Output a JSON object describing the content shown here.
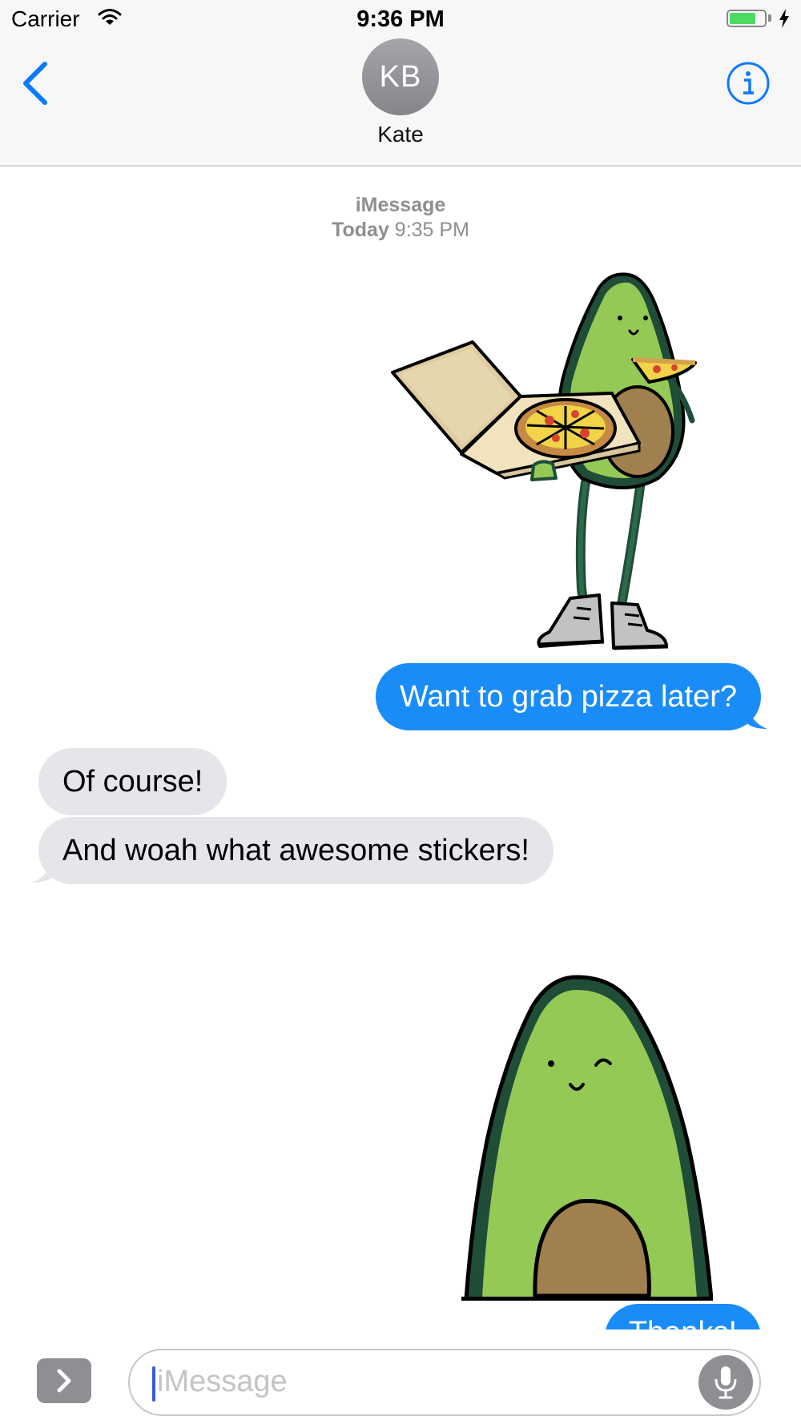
{
  "status_bar": {
    "carrier": "Carrier",
    "time": "9:36 PM",
    "battery_level": 0.75,
    "icons": [
      "wifi-icon",
      "battery-icon",
      "charging-bolt-icon"
    ]
  },
  "nav": {
    "back_icon": "chevron-left-icon",
    "avatar_initials": "KB",
    "contact_name": "Kate",
    "info_icon": "info-icon"
  },
  "thread": {
    "service": "iMessage",
    "day": "Today",
    "time": "9:35 PM",
    "messages": [
      {
        "type": "sticker",
        "from": "me",
        "sticker": "avocado-with-pizza-box"
      },
      {
        "type": "text",
        "from": "me",
        "text": "Want to grab pizza later?"
      },
      {
        "type": "text",
        "from": "them",
        "text": "Of course!"
      },
      {
        "type": "text",
        "from": "them",
        "text": "And woah what awesome stickers!"
      },
      {
        "type": "sticker",
        "from": "me",
        "sticker": "winking-avocado"
      },
      {
        "type": "text",
        "from": "me",
        "text": "Thanks!"
      }
    ]
  },
  "input": {
    "apps_icon": "chevron-right-icon",
    "placeholder": "iMessage",
    "mic_icon": "microphone-icon"
  },
  "colors": {
    "accent": "#0a7aff",
    "sent_bubble": "#1a8cf7",
    "received_bubble": "#e5e5ea",
    "avocado_green": "#95c956",
    "avocado_dark": "#1f4d37",
    "pit_brown": "#a0804f"
  }
}
